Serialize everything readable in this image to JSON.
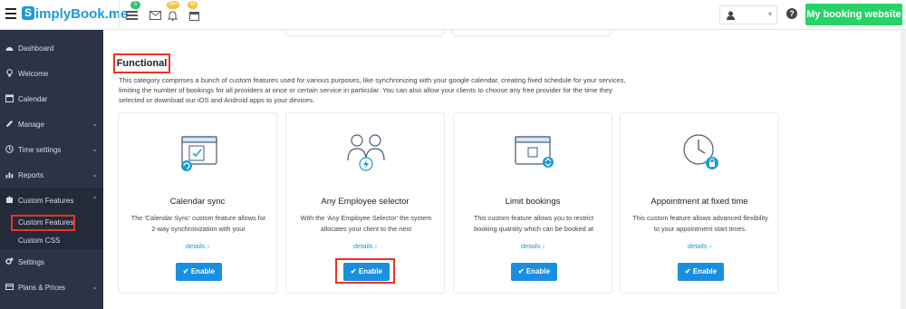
{
  "header": {
    "logo_text": "implyBook.me",
    "logo_letter": "S",
    "badges": {
      "tasks": "5",
      "notifications": "99+",
      "calendar": "48"
    },
    "cta_label": "My booking website",
    "help_label": "?"
  },
  "sidebar": {
    "items": [
      {
        "label": "Dashboard",
        "icon": "dashboard-icon"
      },
      {
        "label": "Welcome",
        "icon": "bulb-icon"
      },
      {
        "label": "Calendar",
        "icon": "calendar-icon"
      },
      {
        "label": "Manage",
        "icon": "pencil-icon"
      },
      {
        "label": "Time settings",
        "icon": "clock-icon"
      },
      {
        "label": "Reports",
        "icon": "chart-icon"
      },
      {
        "label": "Custom Features",
        "icon": "puzzle-icon"
      },
      {
        "label": "Settings",
        "icon": "gears-icon"
      },
      {
        "label": "Plans & Prices",
        "icon": "card-icon"
      }
    ],
    "subitems": [
      {
        "label": "Custom Features"
      },
      {
        "label": "Custom CSS"
      }
    ]
  },
  "main": {
    "section_title": "Functional",
    "section_desc": "This category comprises a bunch of custom features used for various purposes, like synchronizing with your google calendar, creating fixed schedule for your services, limiting the number of bookings for all providers at once or certain service in particular. You can also allow your clients to choose any free provider for the time they selected or download our iOS and Android apps to your devices.",
    "cards": [
      {
        "title": "Calendar sync",
        "desc": "The 'Calendar Sync' custom feature allows for 2-way synchronization with your",
        "details": "details ›",
        "button": "✔ Enable"
      },
      {
        "title": "Any Employee selector",
        "desc": "With the 'Any Employee Selector' the system allocates your client to the next",
        "details": "details ›",
        "button": "✔ Enable"
      },
      {
        "title": "Limit bookings",
        "desc": "This custom feature allows you to restrict booking quantity which can be booked at",
        "details": "details ›",
        "button": "✔ Enable"
      },
      {
        "title": "Appointment at fixed time",
        "desc": "This custom feature allows advanced flexibility to your appointment start times.",
        "details": "details ›",
        "button": "✔ Enable"
      }
    ]
  },
  "colors": {
    "accent": "#1a9bd7",
    "sidebar": "#2b3446",
    "cta": "#25d366",
    "highlight": "#e32"
  }
}
